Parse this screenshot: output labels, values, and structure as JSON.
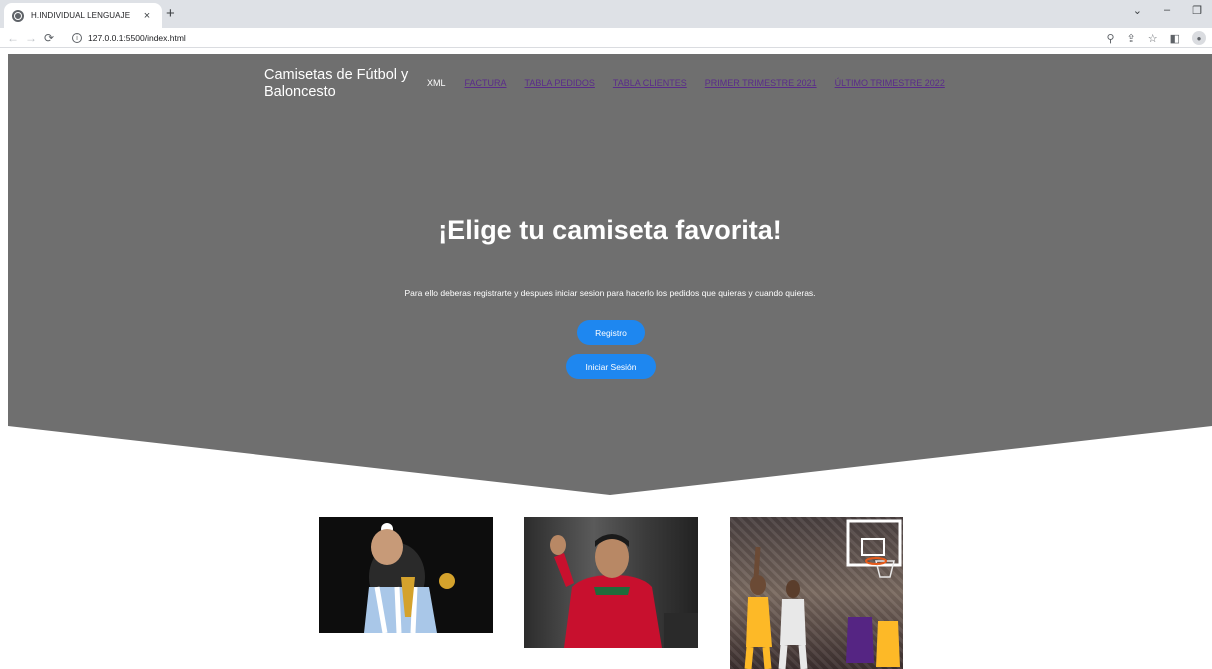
{
  "browser": {
    "tab_title": "H.INDIVIDUAL LENGUAJE",
    "tab_close": "×",
    "new_tab": "+",
    "url": "127.0.0.1:5500/index.html",
    "window_controls": {
      "dropdown": "⌄",
      "minimize": "–",
      "restore": "❐"
    }
  },
  "header": {
    "brand": "Camisetas de Fútbol y Baloncesto",
    "nav": [
      {
        "label": "XML"
      },
      {
        "label": "FACTURA"
      },
      {
        "label": "TABLA PEDIDOS"
      },
      {
        "label": "TABLA CLIENTES"
      },
      {
        "label": "PRIMER TRIMESTRE 2021"
      },
      {
        "label": "ÚLTIMO TRIMESTRE 2022"
      }
    ]
  },
  "hero": {
    "title": "¡Elige tu camiseta favorita!",
    "subtitle": "Para ello deberas registrarte y despues iniciar sesion para hacerlo los pedidos que quieras y cuando quieras.",
    "register_label": "Registro",
    "login_label": "Iniciar Sesión"
  },
  "colors": {
    "hero_bg": "#6f6f6f",
    "button": "#1e87f0",
    "nav_link": "#5a2b8a"
  }
}
